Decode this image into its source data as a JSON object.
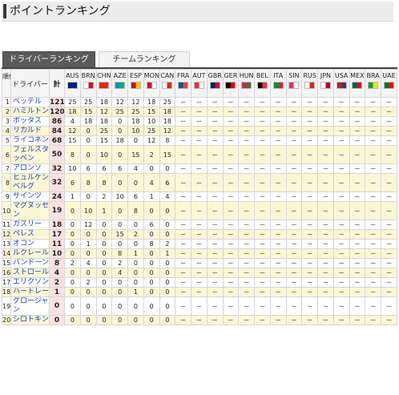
{
  "header": {
    "title": "ポイントランキング"
  },
  "tabs": [
    {
      "label": "ドライバーランキング",
      "active": true
    },
    {
      "label": "チームランキング",
      "active": false
    }
  ],
  "columns": {
    "pos": "順位",
    "driver": "ドライバー",
    "total": "計"
  },
  "races": [
    {
      "code": "AUS",
      "flag": "australia-flag",
      "colors": [
        "#012169",
        "#00247d"
      ]
    },
    {
      "code": "BRN",
      "flag": "bahrain-flag",
      "colors": [
        "#ffffff",
        "#ce1126"
      ]
    },
    {
      "code": "CHN",
      "flag": "china-flag",
      "colors": [
        "#de2910",
        "#de2910"
      ]
    },
    {
      "code": "AZE",
      "flag": "azerbaijan-flag",
      "colors": [
        "#0092bc",
        "#00af66"
      ]
    },
    {
      "code": "ESP",
      "flag": "spain-flag",
      "colors": [
        "#c60b1e",
        "#ffc400"
      ]
    },
    {
      "code": "MON",
      "flag": "monaco-flag",
      "colors": [
        "#ce1126",
        "#ffffff"
      ]
    },
    {
      "code": "CAN",
      "flag": "canada-flag",
      "colors": [
        "#ffffff",
        "#d52b1e"
      ]
    },
    {
      "code": "FRA",
      "flag": "france-flag",
      "colors": [
        "#0055a4",
        "#ef4135"
      ]
    },
    {
      "code": "AUT",
      "flag": "austria-flag",
      "colors": [
        "#ed2939",
        "#ffffff"
      ]
    },
    {
      "code": "GBR",
      "flag": "britain-flag",
      "colors": [
        "#012169",
        "#c8102e"
      ]
    },
    {
      "code": "GER",
      "flag": "germany-flag",
      "colors": [
        "#000000",
        "#dd0000"
      ]
    },
    {
      "code": "HUN",
      "flag": "hungary-flag",
      "colors": [
        "#cd2a3e",
        "#436f4d"
      ]
    },
    {
      "code": "BEL",
      "flag": "belgium-flag",
      "colors": [
        "#000000",
        "#ef3340"
      ]
    },
    {
      "code": "ITA",
      "flag": "italy-flag",
      "colors": [
        "#009246",
        "#ce2b37"
      ]
    },
    {
      "code": "SIN",
      "flag": "singapore-flag",
      "colors": [
        "#ef3340",
        "#ffffff"
      ]
    },
    {
      "code": "RUS",
      "flag": "russia-flag",
      "colors": [
        "#ffffff",
        "#d52b1e"
      ]
    },
    {
      "code": "JPN",
      "flag": "japan-flag",
      "colors": [
        "#ffffff",
        "#bc002d"
      ]
    },
    {
      "code": "USA",
      "flag": "usa-flag",
      "colors": [
        "#b22234",
        "#3c3b6e"
      ]
    },
    {
      "code": "MEX",
      "flag": "mexico-flag",
      "colors": [
        "#006847",
        "#ce1126"
      ]
    },
    {
      "code": "BRA",
      "flag": "brazil-flag",
      "colors": [
        "#009c3b",
        "#ffdf00"
      ]
    },
    {
      "code": "UAE",
      "flag": "uae-flag",
      "colors": [
        "#00732f",
        "#ff0000"
      ]
    }
  ],
  "drivers": [
    {
      "pos": "1",
      "name": "ベッテル",
      "total": "121",
      "results": [
        "25",
        "25",
        "18",
        "12",
        "12",
        "18",
        "25"
      ]
    },
    {
      "pos": "2",
      "name": "ハミルトン",
      "total": "120",
      "results": [
        "18",
        "15",
        "12",
        "25",
        "25",
        "15",
        "18"
      ]
    },
    {
      "pos": "3",
      "name": "ボッタス",
      "total": "86",
      "results": [
        "4",
        "18",
        "18",
        "0",
        "18",
        "10",
        "18"
      ]
    },
    {
      "pos": "4",
      "name": "リカルド",
      "total": "84",
      "results": [
        "12",
        "0",
        "25",
        "0",
        "10",
        "25",
        "12"
      ]
    },
    {
      "pos": "5",
      "name": "ライコネン",
      "total": "68",
      "results": [
        "15",
        "0",
        "15",
        "18",
        "0",
        "12",
        "8"
      ]
    },
    {
      "pos": "6",
      "name": "フェルスタッペン",
      "total": "50",
      "results": [
        "8",
        "0",
        "10",
        "0",
        "15",
        "2",
        "15"
      ]
    },
    {
      "pos": "7",
      "name": "アロンソ",
      "total": "32",
      "results": [
        "10",
        "6",
        "6",
        "6",
        "4",
        "0",
        "0"
      ]
    },
    {
      "pos": "8",
      "name": "ヒュルケンベルグ",
      "total": "32",
      "results": [
        "6",
        "8",
        "8",
        "0",
        "0",
        "4",
        "6"
      ]
    },
    {
      "pos": "9",
      "name": "サインツ",
      "total": "24",
      "results": [
        "1",
        "0",
        "2",
        "10",
        "6",
        "1",
        "4"
      ]
    },
    {
      "pos": "10",
      "name": "マグヌッセン",
      "total": "19",
      "results": [
        "0",
        "10",
        "1",
        "0",
        "8",
        "0",
        "0"
      ]
    },
    {
      "pos": "11",
      "name": "ガスリー",
      "total": "18",
      "results": [
        "0",
        "12",
        "0",
        "0",
        "0",
        "6",
        "0"
      ]
    },
    {
      "pos": "12",
      "name": "ペレス",
      "total": "17",
      "results": [
        "0",
        "0",
        "0",
        "15",
        "2",
        "0",
        "0"
      ]
    },
    {
      "pos": "13",
      "name": "オコン",
      "total": "11",
      "results": [
        "0",
        "1",
        "0",
        "0",
        "0",
        "8",
        "2"
      ]
    },
    {
      "pos": "14",
      "name": "ルクレール",
      "total": "10",
      "results": [
        "0",
        "0",
        "0",
        "8",
        "1",
        "0",
        "1"
      ]
    },
    {
      "pos": "15",
      "name": "バンドーン",
      "total": "8",
      "results": [
        "2",
        "4",
        "0",
        "2",
        "0",
        "0",
        "0"
      ]
    },
    {
      "pos": "16",
      "name": "ストロール",
      "total": "4",
      "results": [
        "0",
        "0",
        "0",
        "4",
        "0",
        "0",
        "0"
      ]
    },
    {
      "pos": "17",
      "name": "エリクソン",
      "total": "2",
      "results": [
        "0",
        "2",
        "0",
        "0",
        "0",
        "0",
        "0"
      ]
    },
    {
      "pos": "18",
      "name": "ハートレー",
      "total": "1",
      "results": [
        "0",
        "0",
        "0",
        "0",
        "1",
        "0",
        "0"
      ]
    },
    {
      "pos": "19",
      "name": "グロージャン",
      "total": "0",
      "results": [
        "0",
        "0",
        "0",
        "0",
        "0",
        "0",
        "0"
      ]
    },
    {
      "pos": "20",
      "name": "シロトキン",
      "total": "0",
      "results": [
        "0",
        "0",
        "0",
        "0",
        "0",
        "0",
        "0"
      ]
    }
  ],
  "pending_mark": "－"
}
